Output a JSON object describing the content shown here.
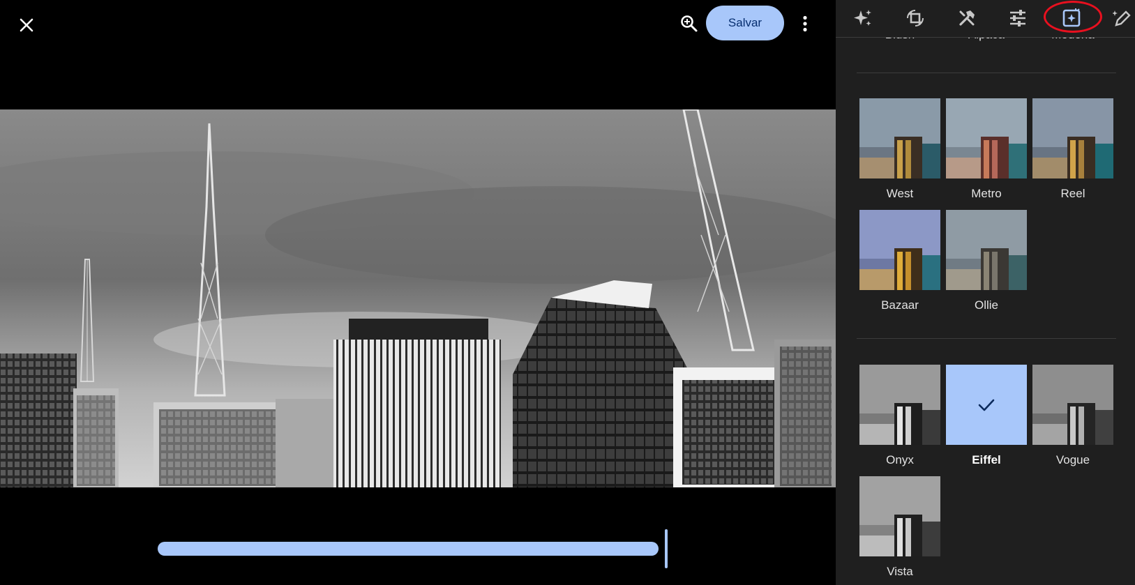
{
  "toolbar": {
    "close_icon": "close-icon",
    "zoom_icon": "zoom-in-icon",
    "save_label": "Salvar",
    "more_icon": "more-vert-icon"
  },
  "photo": {
    "description_icon": "photo-skyline-image"
  },
  "slider": {
    "value": 1.0
  },
  "tabs": [
    {
      "icon": "auto-enhance-icon"
    },
    {
      "icon": "crop-rotate-icon"
    },
    {
      "icon": "tools-icon"
    },
    {
      "icon": "adjust-icon"
    },
    {
      "icon": "filters-icon",
      "active": true
    },
    {
      "icon": "markup-icon"
    }
  ],
  "top_row": [
    "Blush",
    "Alpaca",
    "Modena"
  ],
  "filters": [
    {
      "name": "West"
    },
    {
      "name": "Metro"
    },
    {
      "name": "Reel"
    },
    {
      "name": "Bazaar"
    },
    {
      "name": "Ollie"
    },
    {
      "name": "Onyx"
    },
    {
      "name": "Eiffel",
      "selected": true
    },
    {
      "name": "Vogue"
    },
    {
      "name": "Vista"
    }
  ],
  "colors": {
    "accent": "#a8c7fa",
    "panel": "#1f1f1f",
    "highlight_circle": "#e8101f"
  }
}
